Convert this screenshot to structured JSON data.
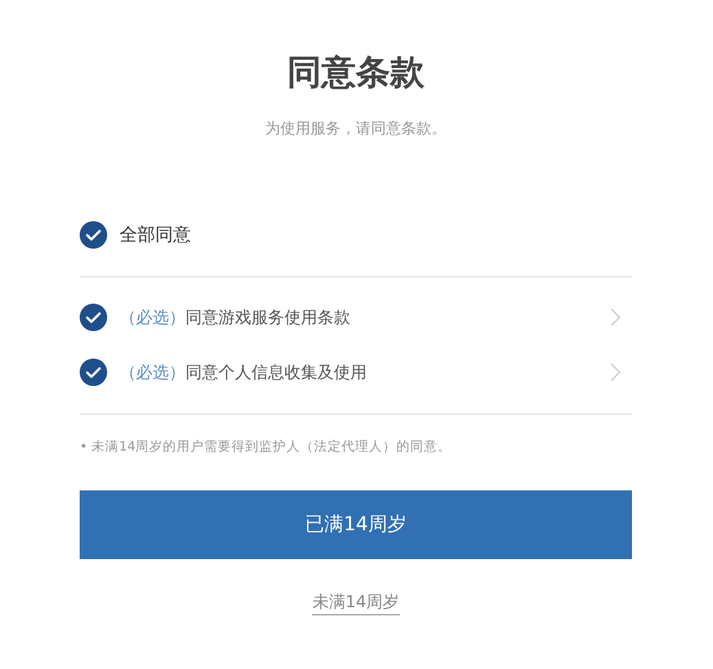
{
  "title": "同意条款",
  "subtitle": "为使用服务，请同意条款。",
  "agree_all": {
    "label": "全部同意",
    "checked": true
  },
  "items": [
    {
      "tag": "（必选）",
      "label": "同意游戏服务使用条款",
      "checked": true
    },
    {
      "tag": "（必选）",
      "label": "同意个人信息收集及使用",
      "checked": true
    }
  ],
  "note": "• 未满14周岁的用户需要得到监护人（法定代理人）的同意。",
  "primary_button": "已满14周岁",
  "secondary_link": "未满14周岁"
}
